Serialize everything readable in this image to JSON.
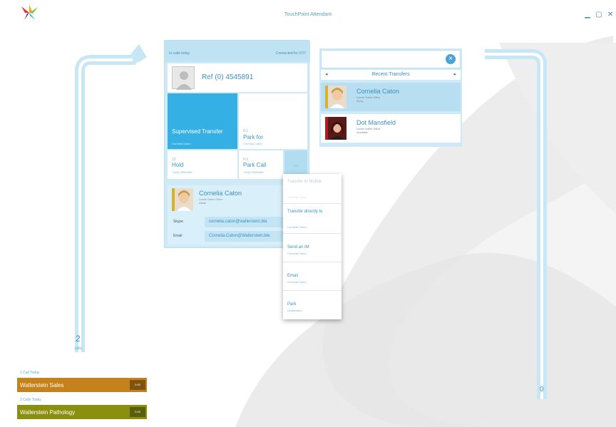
{
  "app": {
    "title": "TouchPoint Attendant",
    "controls": {
      "minimize": "▁",
      "maximize": "▢",
      "close": "✕"
    }
  },
  "left_track": {
    "count": "2",
    "label": "calls"
  },
  "right_track": {
    "count": "0"
  },
  "call_card": {
    "header_left": "In calls today",
    "header_right": "Connected for 0:07",
    "caller_number": "Ref (0) 4545891",
    "tiles": [
      {
        "num": "",
        "label": "Supervised Transfer",
        "sub": "Cornelia Caton"
      },
      {
        "num": "0-1",
        "label": "Park for",
        "sub": "Cornelia Caton"
      },
      {
        "num": "13",
        "label": "Hold",
        "sub": "+44(0) 5550456"
      },
      {
        "num": "0-1",
        "label": "Park Call",
        "sub": "+44(0) 5550456"
      },
      {
        "num": "",
        "label": "",
        "sub": "",
        "more": "..."
      }
    ],
    "contact": {
      "name": "Cornelia Caton",
      "company": "Leeds Sales Office",
      "status": "Away",
      "fields": [
        {
          "label": "Skype",
          "value": "cornelia.caton@wallerstein.bla"
        },
        {
          "label": "Email",
          "value": "Cornelia.Caton@Wallerstein.bla"
        }
      ]
    }
  },
  "menu": {
    "items": [
      {
        "label": "Transfer to Mobile",
        "sub": "Cornelia Caton",
        "disabled": true
      },
      {
        "label": "Transfer directly to",
        "sub": "Cornelia Caton",
        "disabled": false
      },
      {
        "label": "Send an IM",
        "sub": "Cornelia Caton",
        "disabled": false
      },
      {
        "label": "Email",
        "sub": "Cornelia Caton",
        "disabled": false
      },
      {
        "label": "Park",
        "sub": "Unattended",
        "disabled": false
      }
    ]
  },
  "search": {
    "placeholder": "",
    "clear_icon": "×",
    "nav_prev": "◂",
    "nav_next": "▸",
    "nav_title": "Recent Transfers",
    "people": [
      {
        "name": "Cornelia Caton",
        "company": "Leeds Sales Office",
        "status": "Away",
        "color": "#d8b12a",
        "selected": true
      },
      {
        "name": "Dot Mansfield",
        "company": "Leeds Sales Office",
        "status": "Available",
        "color": "#b01d22",
        "selected": false
      }
    ]
  },
  "queues": [
    {
      "count": "1 Call Today",
      "name": "Wallerstein Sales",
      "badge": "0:45",
      "color": "#c5821a"
    },
    {
      "count": "3 Calls Today",
      "name": "Wallerstein Pathology",
      "badge": "0:45",
      "color": "#8a8f10"
    }
  ],
  "colors": {
    "accent": "#35b0e4",
    "card_bg": "#cfeaf6",
    "track": "#b8e0f2"
  }
}
